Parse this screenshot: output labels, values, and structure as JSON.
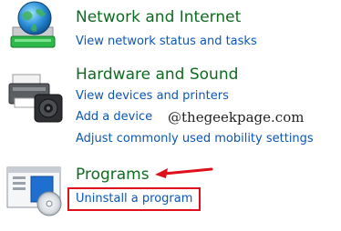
{
  "sections": [
    {
      "title": "Network and Internet",
      "icon": "network-globe-icon",
      "links": [
        "View network status and tasks"
      ]
    },
    {
      "title": "Hardware and Sound",
      "icon": "printer-speaker-icon",
      "links": [
        "View devices and printers",
        "Add a device",
        "Adjust commonly used mobility settings"
      ]
    },
    {
      "title": "Programs",
      "icon": "programs-disc-icon",
      "links": [
        "Uninstall a program"
      ]
    }
  ],
  "watermark": "@thegeekpage.com",
  "colors": {
    "title_green": "#0e6b20",
    "link_blue": "#0a56b8",
    "annotation_red": "#e0101a"
  }
}
